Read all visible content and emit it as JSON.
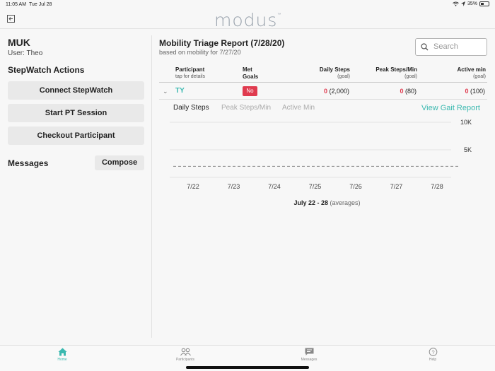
{
  "status_bar": {
    "time": "11:05 AM",
    "date": "Tue Jul 28",
    "battery": "35%"
  },
  "app": {
    "logo_text": "modus",
    "logo_mark": "™"
  },
  "sidebar": {
    "org": "MUK",
    "user": "User: Theo",
    "actions_title": "StepWatch Actions",
    "actions": [
      "Connect StepWatch",
      "Start PT Session",
      "Checkout Participant"
    ],
    "messages_title": "Messages",
    "compose_label": "Compose"
  },
  "report": {
    "title": "Mobility Triage Report (7/28/20)",
    "subtitle": "based on mobility for 7/27/20",
    "search_placeholder": "Search",
    "columns": {
      "participant": "Participant",
      "participant_sub": "tap for details",
      "met_goals_1": "Met",
      "met_goals_2": "Goals",
      "daily_steps": "Daily Steps",
      "daily_steps_sub": "(goal)",
      "peak": "Peak Steps/Min",
      "peak_sub": "(goal)",
      "active": "Active min",
      "active_sub": "(goal)"
    },
    "rows": [
      {
        "participant": "TY",
        "met_goals": "No",
        "daily_steps": "0",
        "daily_steps_goal": "(2,000)",
        "peak": "0",
        "peak_goal": "(80)",
        "active": "0",
        "active_goal": "(100)"
      }
    ],
    "tabs": [
      "Daily Steps",
      "Peak Steps/Min",
      "Active Min"
    ],
    "active_tab": "Daily Steps",
    "gait_link": "View Gait Report",
    "range_label": "July 22 - 28",
    "range_suffix": "(averages)"
  },
  "chart_data": {
    "type": "bar",
    "categories": [
      "7/22",
      "7/23",
      "7/24",
      "7/25",
      "7/26",
      "7/27",
      "7/28"
    ],
    "values": [
      0,
      0,
      0,
      0,
      0,
      0,
      0
    ],
    "y_ticks": [
      "10K",
      "5K"
    ],
    "ylim": [
      0,
      10000
    ],
    "goal_line": 2000,
    "grid": true
  },
  "tabbar": {
    "items": [
      {
        "label": "Home",
        "active": true
      },
      {
        "label": "Participants",
        "active": false
      },
      {
        "label": "Messages",
        "active": false
      },
      {
        "label": "Help",
        "active": false
      }
    ]
  },
  "colors": {
    "accent": "#3bb9b0",
    "alert": "#e03b4f",
    "logo": "#9aa3ad"
  }
}
